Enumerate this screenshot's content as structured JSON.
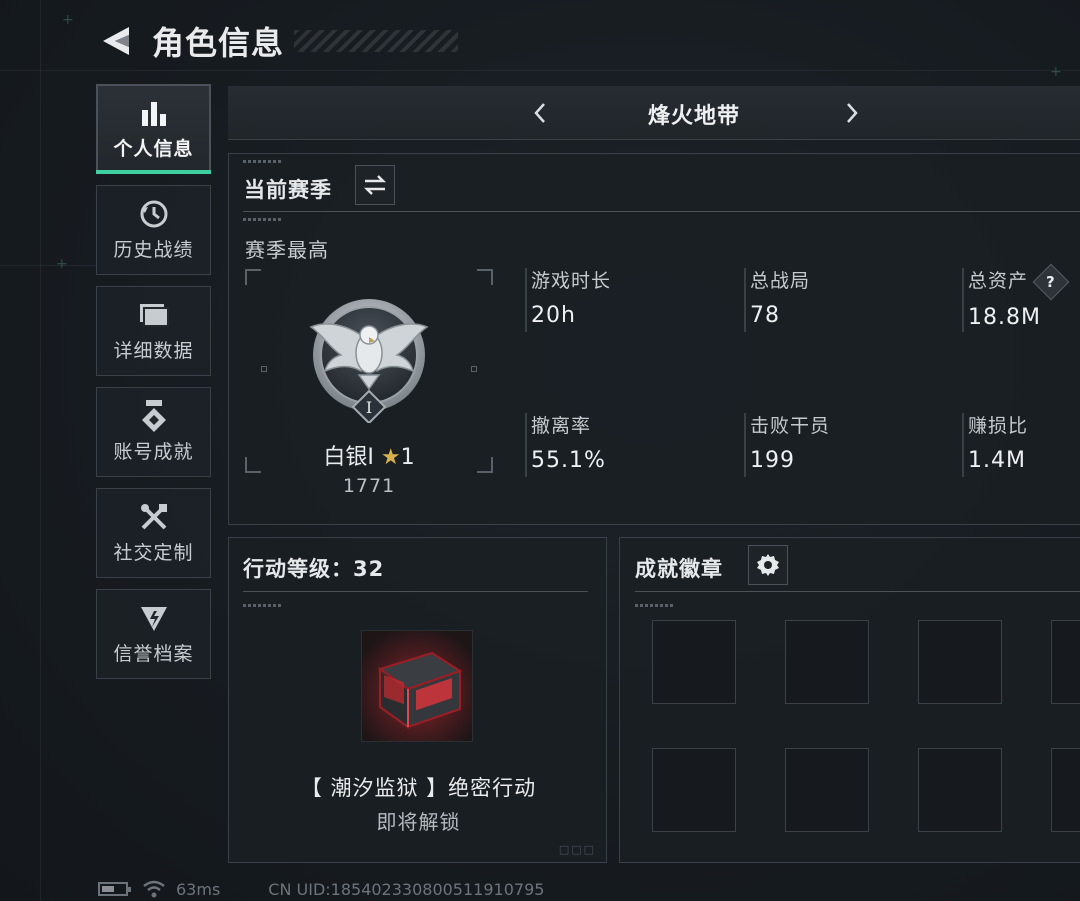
{
  "header": {
    "title": "角色信息"
  },
  "sidebar": {
    "items": [
      {
        "label": "个人信息",
        "icon": "bar-chart-icon",
        "active": true
      },
      {
        "label": "历史战绩",
        "icon": "history-icon",
        "active": false
      },
      {
        "label": "详细数据",
        "icon": "folder-icon",
        "active": false
      },
      {
        "label": "账号成就",
        "icon": "medal-icon",
        "active": false
      },
      {
        "label": "社交定制",
        "icon": "tools-icon",
        "active": false
      },
      {
        "label": "信誉档案",
        "icon": "shield-icon",
        "active": false
      }
    ]
  },
  "mode": {
    "title": "烽火地带"
  },
  "season": {
    "title": "当前赛季",
    "best_label": "赛季最高",
    "rank": {
      "name": "白银I",
      "stars": "1",
      "score": "1771",
      "tier_numeral": "I"
    },
    "stats": [
      {
        "label": "游戏时长",
        "value": "20h"
      },
      {
        "label": "总战局",
        "value": "78"
      },
      {
        "label": "总资产",
        "value": "18.8M",
        "help": "?"
      },
      {
        "label": "撤离率",
        "value": "55.1%"
      },
      {
        "label": "击败干员",
        "value": "199"
      },
      {
        "label": "赚损比",
        "value": "1.4M"
      }
    ]
  },
  "action": {
    "title": "行动等级：32",
    "operation": "【 潮汐监狱 】绝密行动",
    "status": "即将解锁"
  },
  "badges": {
    "title": "成就徽章",
    "slot_count": 8
  },
  "status_bar": {
    "ping": "63ms",
    "uid": "CN UID:185402330800511910795"
  },
  "colors": {
    "accent": "#3fd0a0",
    "gold": "#d8b14a",
    "background": "#161b20"
  }
}
